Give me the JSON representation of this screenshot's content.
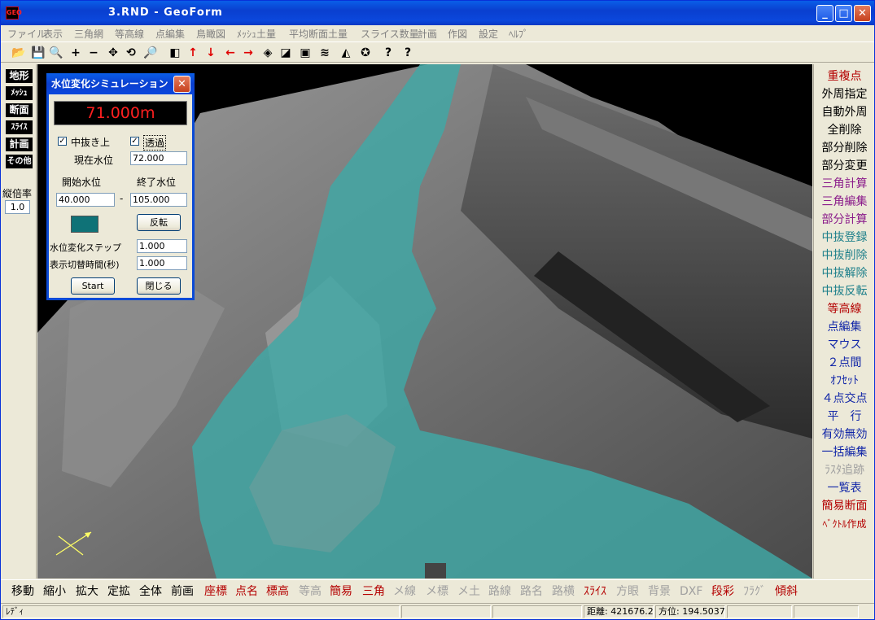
{
  "window": {
    "icon_text": "GEO",
    "title": "3.RND - GeoForm",
    "min": "_",
    "max": "□",
    "close": "✕"
  },
  "menu": [
    "ファイル",
    "表示",
    "三角網",
    "等高線",
    "点編集",
    "鳥瞰図",
    "ﾒｯｼｭ土量",
    "平均断面土量",
    "スライス数量",
    "計画",
    "作図",
    "設定",
    "ﾍﾙﾌﾟ"
  ],
  "toolbar_icons": [
    "open-folder-icon",
    "save-icon",
    "zoom-icon",
    "plus-icon",
    "minus-icon",
    "move-icon",
    "rotate-icon",
    "zoom-fit-icon",
    "cube-icon",
    "arrow-up-icon",
    "arrow-down-icon",
    "arrow-left-icon",
    "arrow-right-icon",
    "view-3d-icon",
    "view-side-icon",
    "window-icon",
    "mesh-icon",
    "terrain-icon",
    "settings-icon",
    "help-icon",
    "context-help-icon"
  ],
  "toolbar_glyphs": [
    "📂",
    "💾",
    "🔍",
    "+",
    "−",
    "✥",
    "⟲",
    "🔎",
    "◧",
    "↑",
    "↓",
    "←",
    "→",
    "◈",
    "◪",
    "▣",
    "≋",
    "◭",
    "✪",
    "?",
    "?"
  ],
  "left_panel": {
    "buttons": [
      "地形",
      "ﾒｯｼｭ",
      "断面",
      "ｽﾗｲｽ",
      "計画",
      "その他"
    ],
    "scale_label": "縦倍率",
    "scale_value": "1.0"
  },
  "right_panel": [
    {
      "label": "重複点",
      "color": "red"
    },
    {
      "label": "外周指定",
      "color": "blk"
    },
    {
      "label": "自動外周",
      "color": "blk"
    },
    {
      "label": "全削除",
      "color": "blk"
    },
    {
      "label": "部分削除",
      "color": "blk"
    },
    {
      "label": "部分変更",
      "color": "blk"
    },
    {
      "label": "三角計算",
      "color": "pur"
    },
    {
      "label": "三角編集",
      "color": "pur"
    },
    {
      "label": "部分計算",
      "color": "pur"
    },
    {
      "label": "中抜登録",
      "color": "teal"
    },
    {
      "label": "中抜削除",
      "color": "teal"
    },
    {
      "label": "中抜解除",
      "color": "teal"
    },
    {
      "label": "中抜反転",
      "color": "teal"
    },
    {
      "label": "等高線",
      "color": "red"
    },
    {
      "label": "点編集",
      "color": "blue"
    },
    {
      "label": "マウス",
      "color": "blue"
    },
    {
      "label": "２点間",
      "color": "blue"
    },
    {
      "label": "ｵﾌｾｯﾄ",
      "color": "blue"
    },
    {
      "label": "４点交点",
      "color": "blue"
    },
    {
      "label": "平　行",
      "color": "blue"
    },
    {
      "label": "有効無効",
      "color": "blue"
    },
    {
      "label": "一括編集",
      "color": "blue"
    },
    {
      "label": "ﾗｽﾀ追跡",
      "color": "gray"
    },
    {
      "label": "一覧表",
      "color": "blue"
    },
    {
      "label": "簡易断面",
      "color": "red"
    },
    {
      "label": "ﾍﾞｸﾄﾙ作成",
      "color": "red"
    }
  ],
  "bottom_bar": [
    {
      "label": "移動",
      "color": "blk"
    },
    {
      "label": "縮小",
      "color": "blk"
    },
    {
      "label": "拡大",
      "color": "blk"
    },
    {
      "label": "定拡",
      "color": "blk"
    },
    {
      "label": "全体",
      "color": "blk"
    },
    {
      "label": "前画",
      "color": "blk"
    },
    {
      "label": "座標",
      "color": "red"
    },
    {
      "label": "点名",
      "color": "red"
    },
    {
      "label": "標高",
      "color": "red"
    },
    {
      "label": "等高",
      "color": "gray"
    },
    {
      "label": "簡易",
      "color": "red"
    },
    {
      "label": "三角",
      "color": "red"
    },
    {
      "label": "メ線",
      "color": "gray"
    },
    {
      "label": "メ標",
      "color": "gray"
    },
    {
      "label": "メ土",
      "color": "gray"
    },
    {
      "label": "路線",
      "color": "gray"
    },
    {
      "label": "路名",
      "color": "gray"
    },
    {
      "label": "路横",
      "color": "gray"
    },
    {
      "label": "ｽﾗｲｽ",
      "color": "red"
    },
    {
      "label": "方眼",
      "color": "gray"
    },
    {
      "label": "背景",
      "color": "gray"
    },
    {
      "label": "DXF",
      "color": "gray"
    },
    {
      "label": "段彩",
      "color": "red"
    },
    {
      "label": "ﾌﾗｸﾞ",
      "color": "gray"
    },
    {
      "label": "傾斜",
      "color": "red"
    }
  ],
  "status": {
    "ready": "ﾚﾃﾞｨ",
    "distance": "距離: 421676.265",
    "bearing": "方位: 194.5037"
  },
  "dialog": {
    "title": "水位変化シミュレーション",
    "display_value": "71.000m",
    "cb_nakanuki_label": "中抜き上",
    "cb_nakanuki_checked": true,
    "cb_transparent_label": "透過",
    "cb_transparent_checked": true,
    "current_level_label": "現在水位",
    "current_level_value": "72.000",
    "start_level_label": "開始水位",
    "end_level_label": "終了水位",
    "start_level_value": "40.000",
    "dash": "-",
    "end_level_value": "105.000",
    "water_color": "#0f7277",
    "reverse_button": "反転",
    "step_label": "水位変化ステップ",
    "step_value": "1.000",
    "interval_label": "表示切替時間(秒)",
    "interval_value": "1.000",
    "start_button": "Start",
    "close_button": "閉じる"
  }
}
